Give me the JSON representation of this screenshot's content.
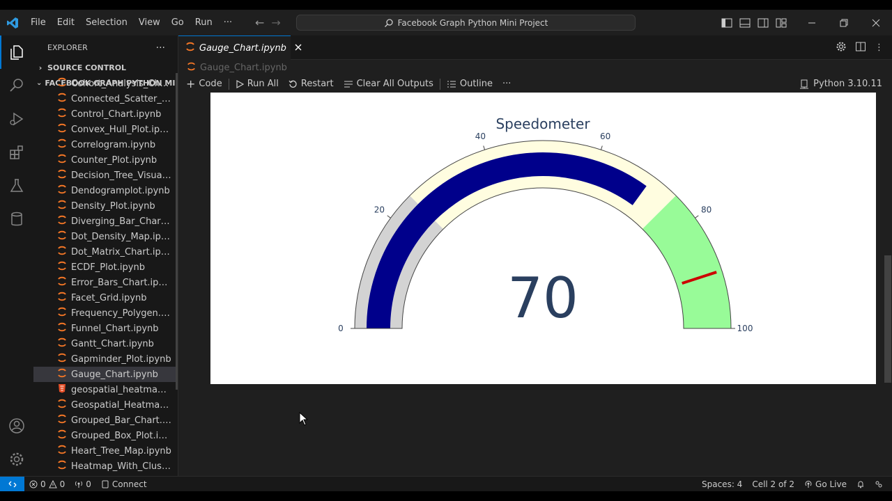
{
  "titlebar": {
    "menu": [
      "File",
      "Edit",
      "Selection",
      "View",
      "Go",
      "Run",
      "···"
    ],
    "search": "Facebook Graph Python Mini Project"
  },
  "sidebar": {
    "title": "EXPLORER",
    "more": "···",
    "source_control": "SOURCE CONTROL",
    "project": "FACEBOOK GRAPH PYTHON MI...",
    "files": [
      {
        "name": "Cohort_Analysis_Chart.i...",
        "type": "notebook"
      },
      {
        "name": "Connected_Scatter_Plot...",
        "type": "notebook"
      },
      {
        "name": "Control_Chart.ipynb",
        "type": "notebook"
      },
      {
        "name": "Convex_Hull_Plot.ipynb",
        "type": "notebook"
      },
      {
        "name": "Correlogram.ipynb",
        "type": "notebook"
      },
      {
        "name": "Counter_Plot.ipynb",
        "type": "notebook"
      },
      {
        "name": "Decision_Tree_Visualisa...",
        "type": "notebook"
      },
      {
        "name": "Dendogramplot.ipynb",
        "type": "notebook"
      },
      {
        "name": "Density_Plot.ipynb",
        "type": "notebook"
      },
      {
        "name": "Diverging_Bar_Chart.ip...",
        "type": "notebook"
      },
      {
        "name": "Dot_Density_Map.ipynb",
        "type": "notebook"
      },
      {
        "name": "Dot_Matrix_Chart.ipynb",
        "type": "notebook"
      },
      {
        "name": "ECDF_Plot.ipynb",
        "type": "notebook"
      },
      {
        "name": "Error_Bars_Chart.ipynb",
        "type": "notebook"
      },
      {
        "name": "Facet_Grid.ipynb",
        "type": "notebook"
      },
      {
        "name": "Frequency_Polygen.ipy...",
        "type": "notebook"
      },
      {
        "name": "Funnel_Chart.ipynb",
        "type": "notebook"
      },
      {
        "name": "Gantt_Chart.ipynb",
        "type": "notebook"
      },
      {
        "name": "Gapminder_Plot.ipynb",
        "type": "notebook"
      },
      {
        "name": "Gauge_Chart.ipynb",
        "type": "notebook",
        "selected": true
      },
      {
        "name": "geospatial_heatmap.html",
        "type": "html"
      },
      {
        "name": "Geospatial_Heatmap.ip...",
        "type": "notebook"
      },
      {
        "name": "Grouped_Bar_Chart.ipy...",
        "type": "notebook"
      },
      {
        "name": "Grouped_Box_Plot.ipynb",
        "type": "notebook"
      },
      {
        "name": "Heart_Tree_Map.ipynb",
        "type": "notebook"
      },
      {
        "name": "Heatmap_With_Clusteri...",
        "type": "notebook"
      }
    ]
  },
  "editor": {
    "tab": "Gauge_Chart.ipynb",
    "breadcrumb": "Gauge_Chart.ipynb",
    "toolbar": {
      "code": "Code",
      "run_all": "Run All",
      "restart": "Restart",
      "clear_outputs": "Clear All Outputs",
      "outline": "Outline",
      "more": "···"
    },
    "kernel": "Python 3.10.11"
  },
  "chart_data": {
    "type": "gauge",
    "title": "Speedometer",
    "value": 70,
    "value_label": "70",
    "range": [
      0,
      100
    ],
    "ticks": [
      0,
      20,
      40,
      60,
      80,
      100
    ],
    "tick_labels": [
      "0",
      "20",
      "40",
      "60",
      "80",
      "100"
    ],
    "bar_color": "#00008b",
    "steps": [
      {
        "range": [
          0,
          25
        ],
        "color": "#d3d3d3"
      },
      {
        "range": [
          25,
          75
        ],
        "color": "#fffde0"
      },
      {
        "range": [
          75,
          100
        ],
        "color": "#98fb98"
      }
    ],
    "threshold": {
      "value": 90,
      "color": "#cc0000"
    },
    "title_color": "#2a3f5f"
  },
  "statusbar": {
    "errors": "0",
    "warnings": "0",
    "ports": "0",
    "connect": "Connect",
    "spaces": "Spaces: 4",
    "cell": "Cell 2 of 2",
    "golive": "Go Live"
  }
}
